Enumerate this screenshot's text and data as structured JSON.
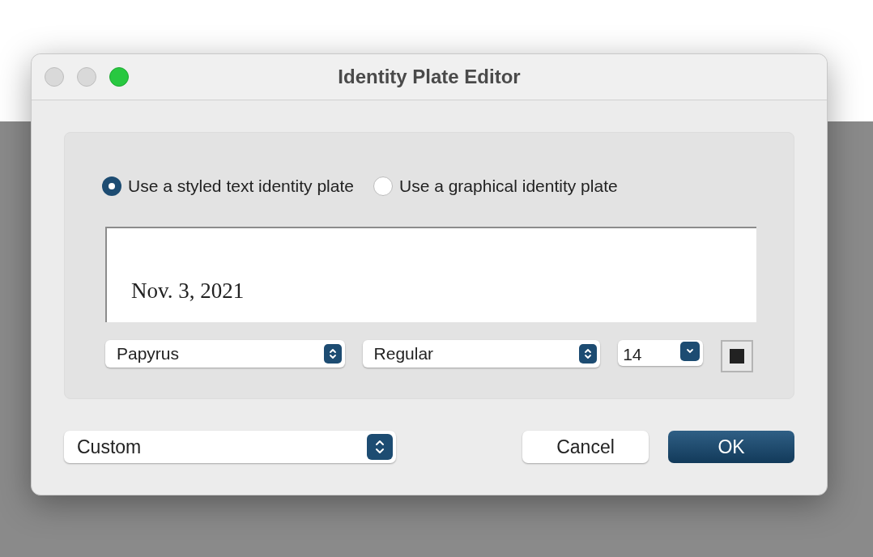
{
  "window": {
    "title": "Identity Plate Editor",
    "traffic_lights": [
      {
        "active": false
      },
      {
        "active": false
      },
      {
        "active": true
      }
    ]
  },
  "plate_type": [
    {
      "label": "Use a styled text identity plate",
      "selected": true
    },
    {
      "label": "Use a graphical identity plate",
      "selected": false
    }
  ],
  "preview": {
    "text": "Nov. 3, 2021"
  },
  "font": {
    "family": "Papyrus",
    "style": "Regular",
    "size": "14"
  },
  "preset": "Custom",
  "buttons": [
    {
      "label": "Cancel",
      "kind": "normal"
    },
    {
      "label": "OK",
      "kind": "default"
    }
  ]
}
